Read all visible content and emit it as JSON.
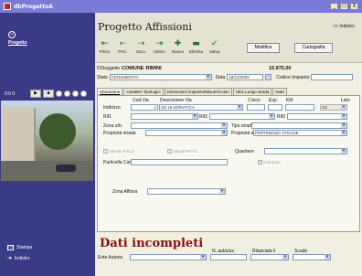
{
  "window": {
    "title": "dbProgettoA",
    "controls": [
      "_",
      "□",
      "X"
    ]
  },
  "sidebar": {
    "home_icon": "circle-arrow-icon",
    "progetto_label": "Progetto",
    "timecode": "0:0 0",
    "media_buttons": [
      "▶",
      "■"
    ],
    "stampa_label": "Stampa",
    "indietro_label": "Indietro"
  },
  "header": {
    "title": "Progetto Affissioni",
    "back_label": "<< Indietro",
    "modifica_label": "Modifica",
    "cartografia_label": "Cartografia"
  },
  "toolbar": [
    {
      "label": "Primo",
      "icon": "first-icon",
      "glyph": "⇤"
    },
    {
      "label": "Prec.",
      "icon": "prev-icon",
      "glyph": "⇠"
    },
    {
      "label": "Succ.",
      "icon": "next-icon",
      "glyph": "⇢"
    },
    {
      "label": "Ultimo",
      "icon": "last-icon",
      "glyph": "⇥"
    },
    {
      "label": "Nuovo",
      "icon": "new-icon",
      "glyph": "✚"
    },
    {
      "label": "Elimina",
      "icon": "delete-icon",
      "glyph": "▬"
    },
    {
      "label": "Salva",
      "icon": "save-icon",
      "glyph": "✔"
    }
  ],
  "info": {
    "id_label": "IDSoggetto",
    "comune_label": "COMUNE",
    "comune_value": "RIMINI",
    "id_number": "15.975,00",
    "stato_label": "Stato",
    "stato_value": "CENSIMENTO",
    "data_label": "Data",
    "data_value": "18/12/2002",
    "codice_label": "Codice Impianto",
    "codice_value": ""
  },
  "tabs": [
    "Ubicazione",
    "Caratteri Tipologici",
    "Dimensioni impianto/Misure/Colori",
    "Ubic.Lungo strada",
    "Note"
  ],
  "ubicazione": {
    "col_cod_via": "Cod.Via",
    "col_descrizione_via": "Descrizione Via",
    "col_civico": "Civico",
    "col_esp": "Esp.",
    "col_km": "KM",
    "col_lato": "Lato",
    "indirizzo_label": "Indirizzo",
    "cod_via_value": "1",
    "descrizione_value": "SS 16 ADRIATICA",
    "civico_value": "",
    "esp_value": "",
    "km_value": "",
    "lato_value": "SX",
    "rif1_label": "Rif1",
    "rif2_label": "Rif2",
    "rif3_label": "Rif3",
    "zona_urb_label": "Zona urb.",
    "tipo_strada_label": "Tipo strada",
    "proprieta_strada_label": "Proprietà strada",
    "proprieta_area_label": "Proprietà area",
    "proprieta_area_value": "PERTINENZA STRADE",
    "vincolo1_label": "Vincolo P.R.G.",
    "vincolo2_label": "Vincolo P.T.S.",
    "quartiere_label": "Quartiere",
    "particella_label": "Particella Cat.",
    "cat_spec_label": "Cat.Spec",
    "zona_affissa_label": "Zona Affissa"
  },
  "footer": {
    "status_message": "Dati incompleti",
    "ente_label": "Ente Autoriz.",
    "n_autorizz_label": "N. autorizz.",
    "rilasciata_label": "Rilasciata il",
    "scade_label": "Scade"
  }
}
